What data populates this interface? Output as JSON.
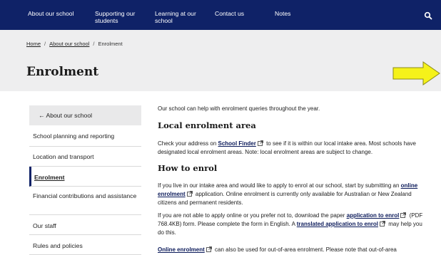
{
  "nav": {
    "items": [
      "About our school",
      "Supporting our students",
      "Learning at our school",
      "Contact us",
      "Notes"
    ],
    "search_icon": "search-icon"
  },
  "breadcrumb": {
    "home": "Home",
    "sep": "/",
    "parent": "About our school",
    "current": "Enrolment"
  },
  "page_title": "Enrolment",
  "sidebar": {
    "back": "← About our school",
    "items": [
      "School planning and reporting",
      "Location and transport",
      "Enrolment",
      "Financial contributions and assistance",
      "Our staff",
      "Rules and policies"
    ]
  },
  "content": {
    "intro": "Our school can help with enrolment queries throughout the year.",
    "h_local": "Local enrolment area",
    "p1_a": "Check your address on ",
    "p1_link": "School Finder",
    "p1_b": " to see if it is within our local intake area. Most schools have designated local enrolment areas. Note: local enrolment areas are subject to change.",
    "h_how": "How to enrol",
    "p2_a": "If you live in our intake area and would like to apply to enrol at our school, start by submitting an ",
    "p2_link": "online enrolment",
    "p2_b": " application. Online enrolment is currently only available for Australian or New Zealand citizens and permanent residents.",
    "p3_a": "If you are not able to apply online or you prefer not to, download the paper ",
    "p3_link1": "application to enrol",
    "p3_b": " (PDF 768.4KB) form. Please complete the form in English. A ",
    "p3_link2": "translated application to enrol",
    "p3_c": " may help you do this.",
    "p4_link": "Online enrolment",
    "p4_b": " can also be used for out-of-area enrolment. Please note that out-of-area"
  },
  "colors": {
    "nav_bg": "#0f2267",
    "band_bg": "#eeeeef",
    "arrow_fill": "#f5f21a"
  }
}
